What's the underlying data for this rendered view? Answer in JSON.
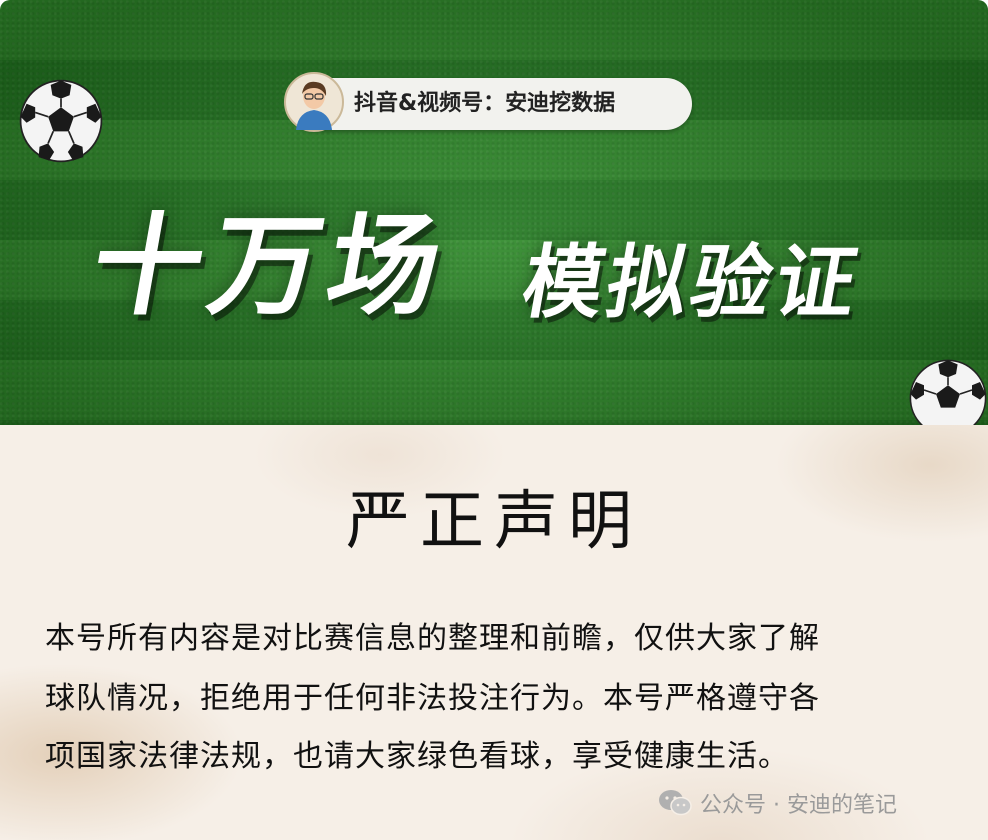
{
  "banner": {
    "pill_text": "抖音&视频号：安迪挖数据",
    "title_big": "十万场",
    "title_small": "模拟验证"
  },
  "declaration": {
    "title": "严正声明",
    "lines": [
      "本号所有内容是对比赛信息的整理和前瞻，仅供大家了解",
      "球队情况，拒绝用于任何非法投注行为。本号严格遵守各",
      "项国家法律法规，也请大家绿色看球，享受健康生活。"
    ]
  },
  "watermark": {
    "text": "公众号 · 安迪的笔记",
    "icon": "wechat-icon"
  },
  "colors": {
    "grass_light": "#2f8a2a",
    "grass_dark": "#247a22",
    "paper": "#f6efe7",
    "text": "#111111",
    "watermark": "#9a9a9a"
  }
}
